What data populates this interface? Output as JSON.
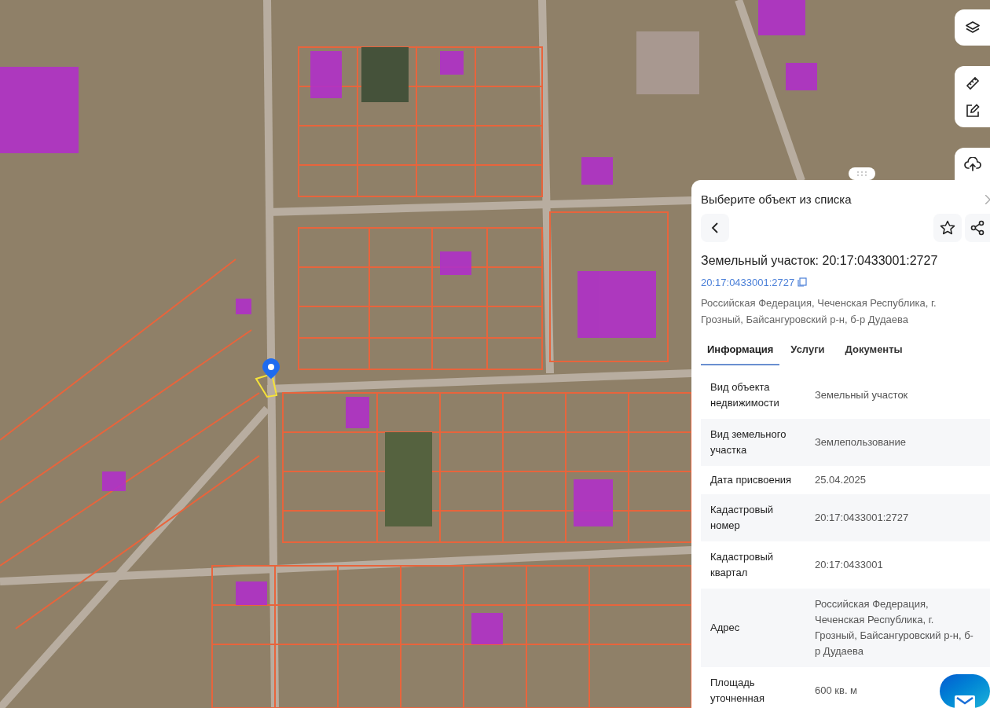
{
  "panel": {
    "title": "Выберите объект из списка",
    "heading": "Земельный участок: 20:17:0433001:2727",
    "number_link": "20:17:0433001:2727",
    "address": "Российская Федерация, Чеченская Республика, г. Грозный, Байсангуровский р-н, б-р Дудаева"
  },
  "tabs": [
    {
      "label": "Информация",
      "selected": true
    },
    {
      "label": "Услуги",
      "selected": false
    },
    {
      "label": "Документы",
      "selected": false
    }
  ],
  "rows": [
    {
      "label": "Вид объекта недвижимости",
      "value": "Земельный участок"
    },
    {
      "label": "Вид земельного участка",
      "value": "Землепользование"
    },
    {
      "label": "Дата присвоения",
      "value": "25.04.2025"
    },
    {
      "label": "Кадастровый номер",
      "value": "20:17:0433001:2727"
    },
    {
      "label": "Кадастровый квартал",
      "value": "20:17:0433001"
    },
    {
      "label": "Адрес",
      "value": "Российская Федерация, Чеченская Республика, г. Грозный, Байсангуровский р-н, б-р Дудаева"
    },
    {
      "label": "Площадь уточненная",
      "value": "600 кв. м"
    }
  ]
}
